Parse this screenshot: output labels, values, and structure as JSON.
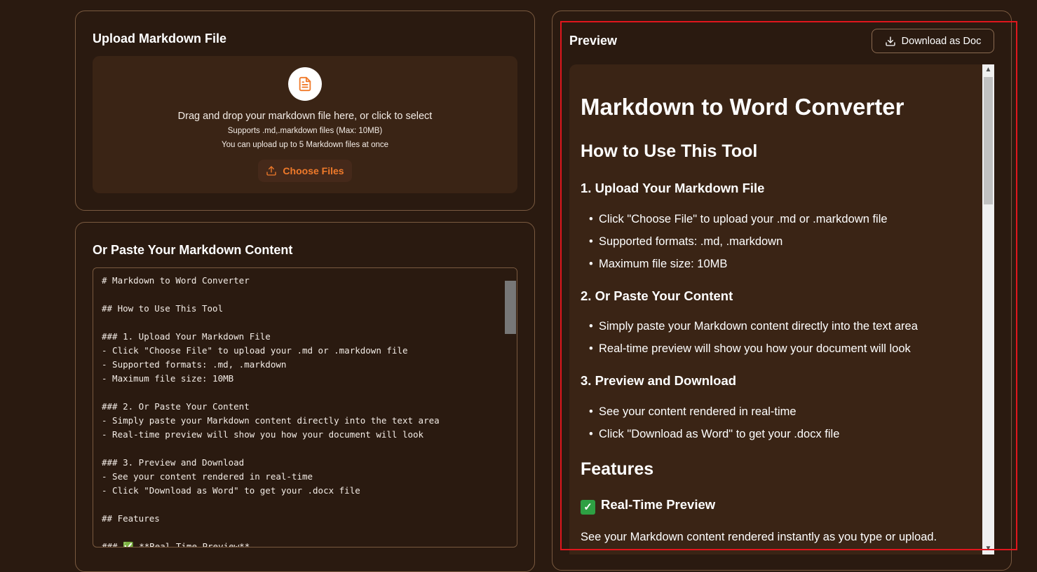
{
  "upload": {
    "title": "Upload Markdown File",
    "drop_text": "Drag and drop your markdown file here, or click to select",
    "supports_text": "Supports .md,.markdown files (Max: 10MB)",
    "limit_text": "You can upload up to 5 Markdown files at once",
    "choose_label": "Choose Files"
  },
  "paste": {
    "title": "Or Paste Your Markdown Content",
    "content": "# Markdown to Word Converter\n\n## How to Use This Tool\n\n### 1. Upload Your Markdown File\n- Click \"Choose File\" to upload your .md or .markdown file\n- Supported formats: .md, .markdown\n- Maximum file size: 10MB\n\n### 2. Or Paste Your Content\n- Simply paste your Markdown content directly into the text area\n- Real-time preview will show you how your document will look\n\n### 3. Preview and Download\n- See your content rendered in real-time\n- Click \"Download as Word\" to get your .docx file\n\n## Features\n\n### ✅ **Real-Time Preview**"
  },
  "preview": {
    "title": "Preview",
    "download_label": "Download as Doc",
    "h1": "Markdown to Word Converter",
    "h2_how": "How to Use This Tool",
    "h3_upload": "1. Upload Your Markdown File",
    "upload_items": [
      "Click \"Choose File\" to upload your .md or .markdown file",
      "Supported formats: .md, .markdown",
      "Maximum file size: 10MB"
    ],
    "h3_paste": "2. Or Paste Your Content",
    "paste_items": [
      "Simply paste your Markdown content directly into the text area",
      "Real-time preview will show you how your document will look"
    ],
    "h3_download": "3. Preview and Download",
    "download_items": [
      "See your content rendered in real-time",
      "Click \"Download as Word\" to get your .docx file"
    ],
    "h2_features": "Features",
    "h3_realtime": "Real-Time Preview",
    "realtime_text": "See your Markdown content rendered instantly as you type or upload."
  },
  "colors": {
    "background": "#2a1a10",
    "accent": "#f07a2a",
    "highlight_box": "#e0161d"
  }
}
